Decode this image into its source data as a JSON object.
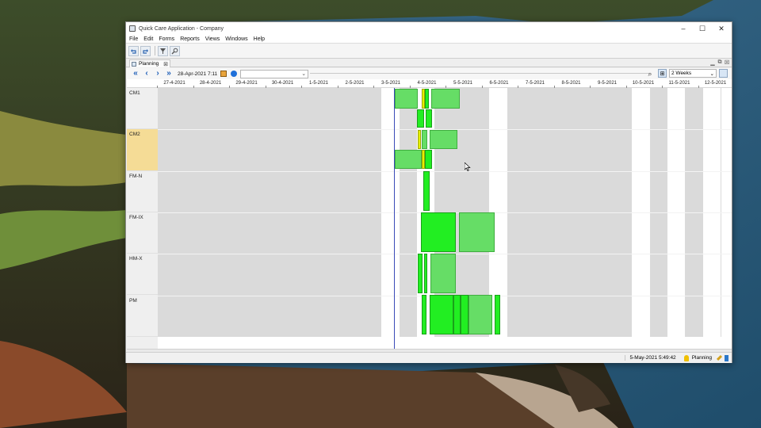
{
  "window": {
    "title": "Quick Care Application - Company",
    "controls": {
      "minimize": "–",
      "maximize": "☐",
      "close": "✕"
    }
  },
  "menu": [
    "File",
    "Edit",
    "Forms",
    "Reports",
    "Views",
    "Windows",
    "Help"
  ],
  "toolbar": {
    "icons": [
      "undo-icon",
      "redo-icon",
      "filter-icon",
      "search-icon"
    ]
  },
  "document_tab": {
    "label": "Planning",
    "close": "⊠"
  },
  "navigation": {
    "first": "«",
    "prev": "‹",
    "next": "›",
    "last": "»",
    "current_date": "28-Apr-2021 7:11",
    "filter_value": "",
    "filter_arrow": "⌄",
    "range": "2 Weeks",
    "range_arrow": "⌄"
  },
  "timeline": {
    "dates": [
      "27-4-2021",
      "28-4-2021",
      "29-4-2021",
      "30-4-2021",
      "1-5-2021",
      "2-5-2021",
      "3-5-2021",
      "4-5-2021",
      "5-5-2021",
      "6-5-2021",
      "7-5-2021",
      "8-5-2021",
      "9-5-2021",
      "10-5-2021",
      "11-5-2021",
      "12-5-2021"
    ]
  },
  "resources": [
    {
      "label": "CM1",
      "selected": false
    },
    {
      "label": "CM2",
      "selected": true
    },
    {
      "label": "FM-N",
      "selected": false
    },
    {
      "label": "FM-IX",
      "selected": false
    },
    {
      "label": "HM-X",
      "selected": false
    },
    {
      "label": "PM",
      "selected": false
    }
  ],
  "status": {
    "datetime": "5-May-2021 5:49:42",
    "module": "Planning"
  },
  "colors": {
    "task": "#22ee22",
    "task_light": "#66dd66",
    "task_highlight": "#e6f000",
    "selected_resource": "#f5dc96",
    "nonworking": "#dadada",
    "now_line": "#3a4ab8"
  }
}
